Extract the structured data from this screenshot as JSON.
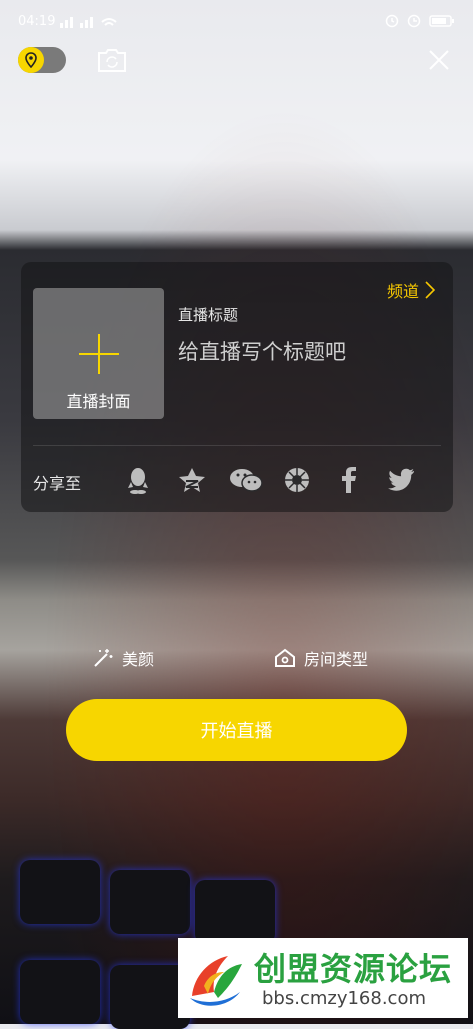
{
  "status": {
    "time": "04:19"
  },
  "card": {
    "cover_label": "直播封面",
    "channel_label": "频道",
    "title_label": "直播标题",
    "title_placeholder": "给直播写个标题吧",
    "share_label": "分享至",
    "share_icons": [
      "qq-icon",
      "qzone-icon",
      "wechat-icon",
      "moments-icon",
      "facebook-icon",
      "twitter-icon"
    ]
  },
  "options": {
    "beauty_label": "美颜",
    "room_type_label": "房间类型"
  },
  "start_button_label": "开始直播",
  "watermark": {
    "title": "创盟资源论坛",
    "url": "bbs.cmzy168.com"
  },
  "colors": {
    "accent": "#f7d600",
    "channel": "#f7c800"
  }
}
